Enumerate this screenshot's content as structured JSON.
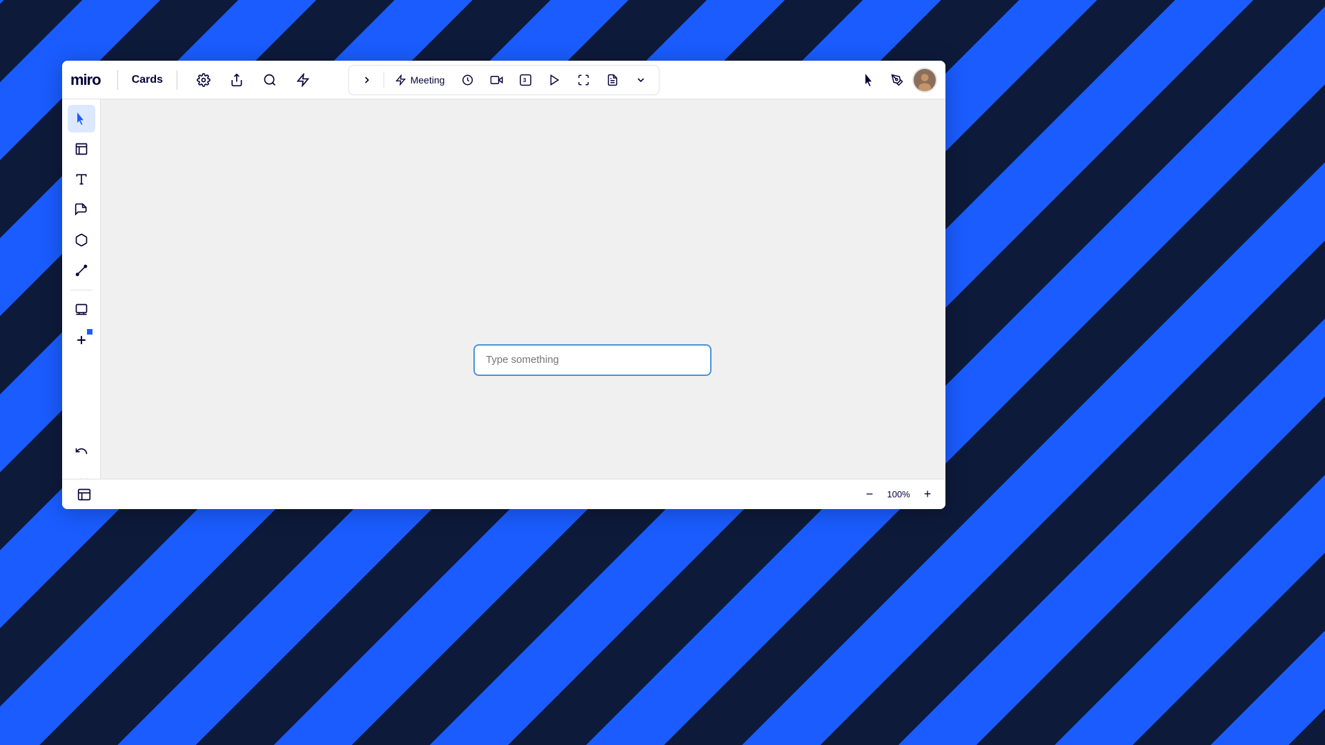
{
  "app": {
    "name": "miro"
  },
  "toolbar": {
    "board_name": "Cards",
    "settings_icon": "⚙",
    "share_icon": "↑",
    "search_icon": "🔍",
    "lightning_icon": "⚡"
  },
  "center_toolbar": {
    "expand_icon": ">",
    "meeting_label": "Meeting",
    "timer_icon": "⏱",
    "camera_icon": "📷",
    "reactions_icon": "3",
    "present_icon": "▶",
    "fullscreen_icon": "⤢",
    "notes_icon": "📋",
    "more_icon": "⌄"
  },
  "right_toolbar": {
    "select_icon": "↖",
    "pen_icon": "✏",
    "avatar_initials": "👤"
  },
  "sidebar": {
    "select_tool": "cursor",
    "frame_tool": "frame",
    "text_tool": "T",
    "sticky_tool": "sticky",
    "shapes_tool": "shapes",
    "line_tool": "line",
    "image_tool": "image",
    "add_tool": "+"
  },
  "canvas": {
    "input_placeholder": "Type something"
  },
  "bottom_bar": {
    "map_icon": "🗺",
    "zoom_minus": "−",
    "zoom_value": "100%",
    "zoom_plus": "+"
  }
}
